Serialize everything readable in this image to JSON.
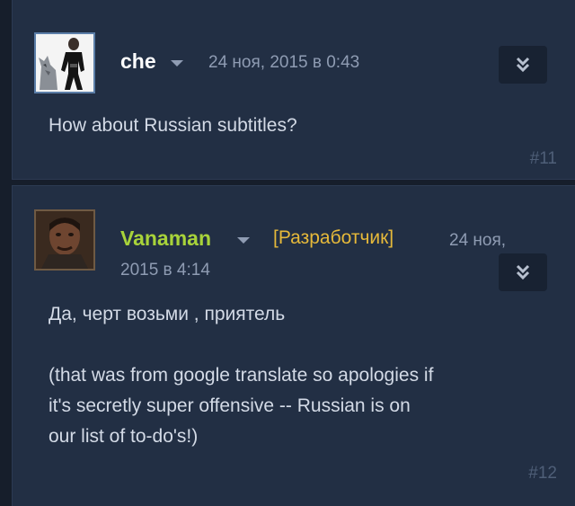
{
  "comments": [
    {
      "author": "che",
      "date": "24 ноя, 2015 в 0:43",
      "text": "How about Russian subtitles?",
      "number": "#11",
      "avatar_icon": "wolf-avatar-icon"
    },
    {
      "author": "Vanaman",
      "role": "[Разработчик]",
      "date_line1": "24 ноя,",
      "date_line2": "2015 в 4:14",
      "text": "Да, черт возьми , приятель\n\n(that was from google translate so apologies if\nit's secretly super offensive -- Russian is on\nour list of to-do's!)",
      "number": "#12",
      "avatar_icon": "man-avatar-icon"
    }
  ],
  "colors": {
    "page_bg": "#161e2b",
    "panel_bg": "#222f44",
    "developer_name": "#a8d33a",
    "developer_tag": "#e6b93a"
  }
}
